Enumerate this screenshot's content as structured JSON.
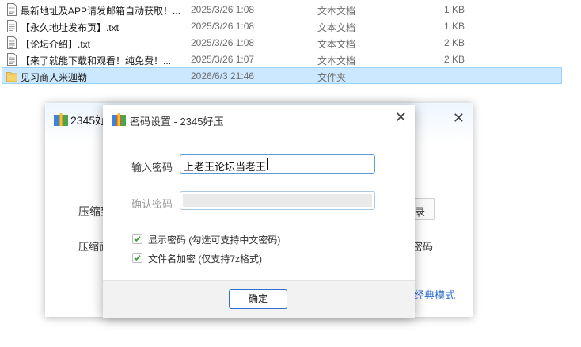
{
  "files": [
    {
      "name": "最新地址及APP请发邮箱自动获取！...",
      "date": "2025/3/26 1:08",
      "type": "文本文档",
      "size": "1 KB",
      "icon": "text-file-icon"
    },
    {
      "name": "【永久地址发布页】.txt",
      "date": "2025/3/26 1:08",
      "type": "文本文档",
      "size": "1 KB",
      "icon": "text-file-icon"
    },
    {
      "name": "【论坛介绍】.txt",
      "date": "2025/3/26 1:08",
      "type": "文本文档",
      "size": "2 KB",
      "icon": "text-file-icon"
    },
    {
      "name": "【来了就能下载和观看！纯免费！...",
      "date": "2025/3/26 1:07",
      "type": "文本文档",
      "size": "2 KB",
      "icon": "text-file-icon"
    },
    {
      "name": "见习商人米迦勒",
      "date": "2026/6/3 21:46",
      "type": "文件夹",
      "size": "",
      "icon": "folder-icon",
      "selected": true
    }
  ],
  "background_window": {
    "title": "2345好",
    "text1": "压缩到",
    "text2": "压缩面",
    "right_button": "录",
    "right_text": "密码",
    "link": "经典模式",
    "icon": "archive-app-icon"
  },
  "dialog": {
    "title": "密码设置 - 2345好压",
    "icon": "archive-app-icon",
    "password_label": "输入密码",
    "password_value": "上老王论坛当老王",
    "confirm_label": "确认密码",
    "confirm_value": "",
    "options": [
      {
        "label": "显示密码 (勾选可支持中文密码)",
        "checked": true
      },
      {
        "label": "文件名加密 (仅支持7z格式)",
        "checked": true
      }
    ],
    "ok_label": "确定"
  },
  "colors": {
    "selection_bg": "#cce8ff",
    "selection_border": "#99d1ff",
    "accent_blue": "#2f6fd0",
    "checkbox_green": "#3b9a3b"
  }
}
